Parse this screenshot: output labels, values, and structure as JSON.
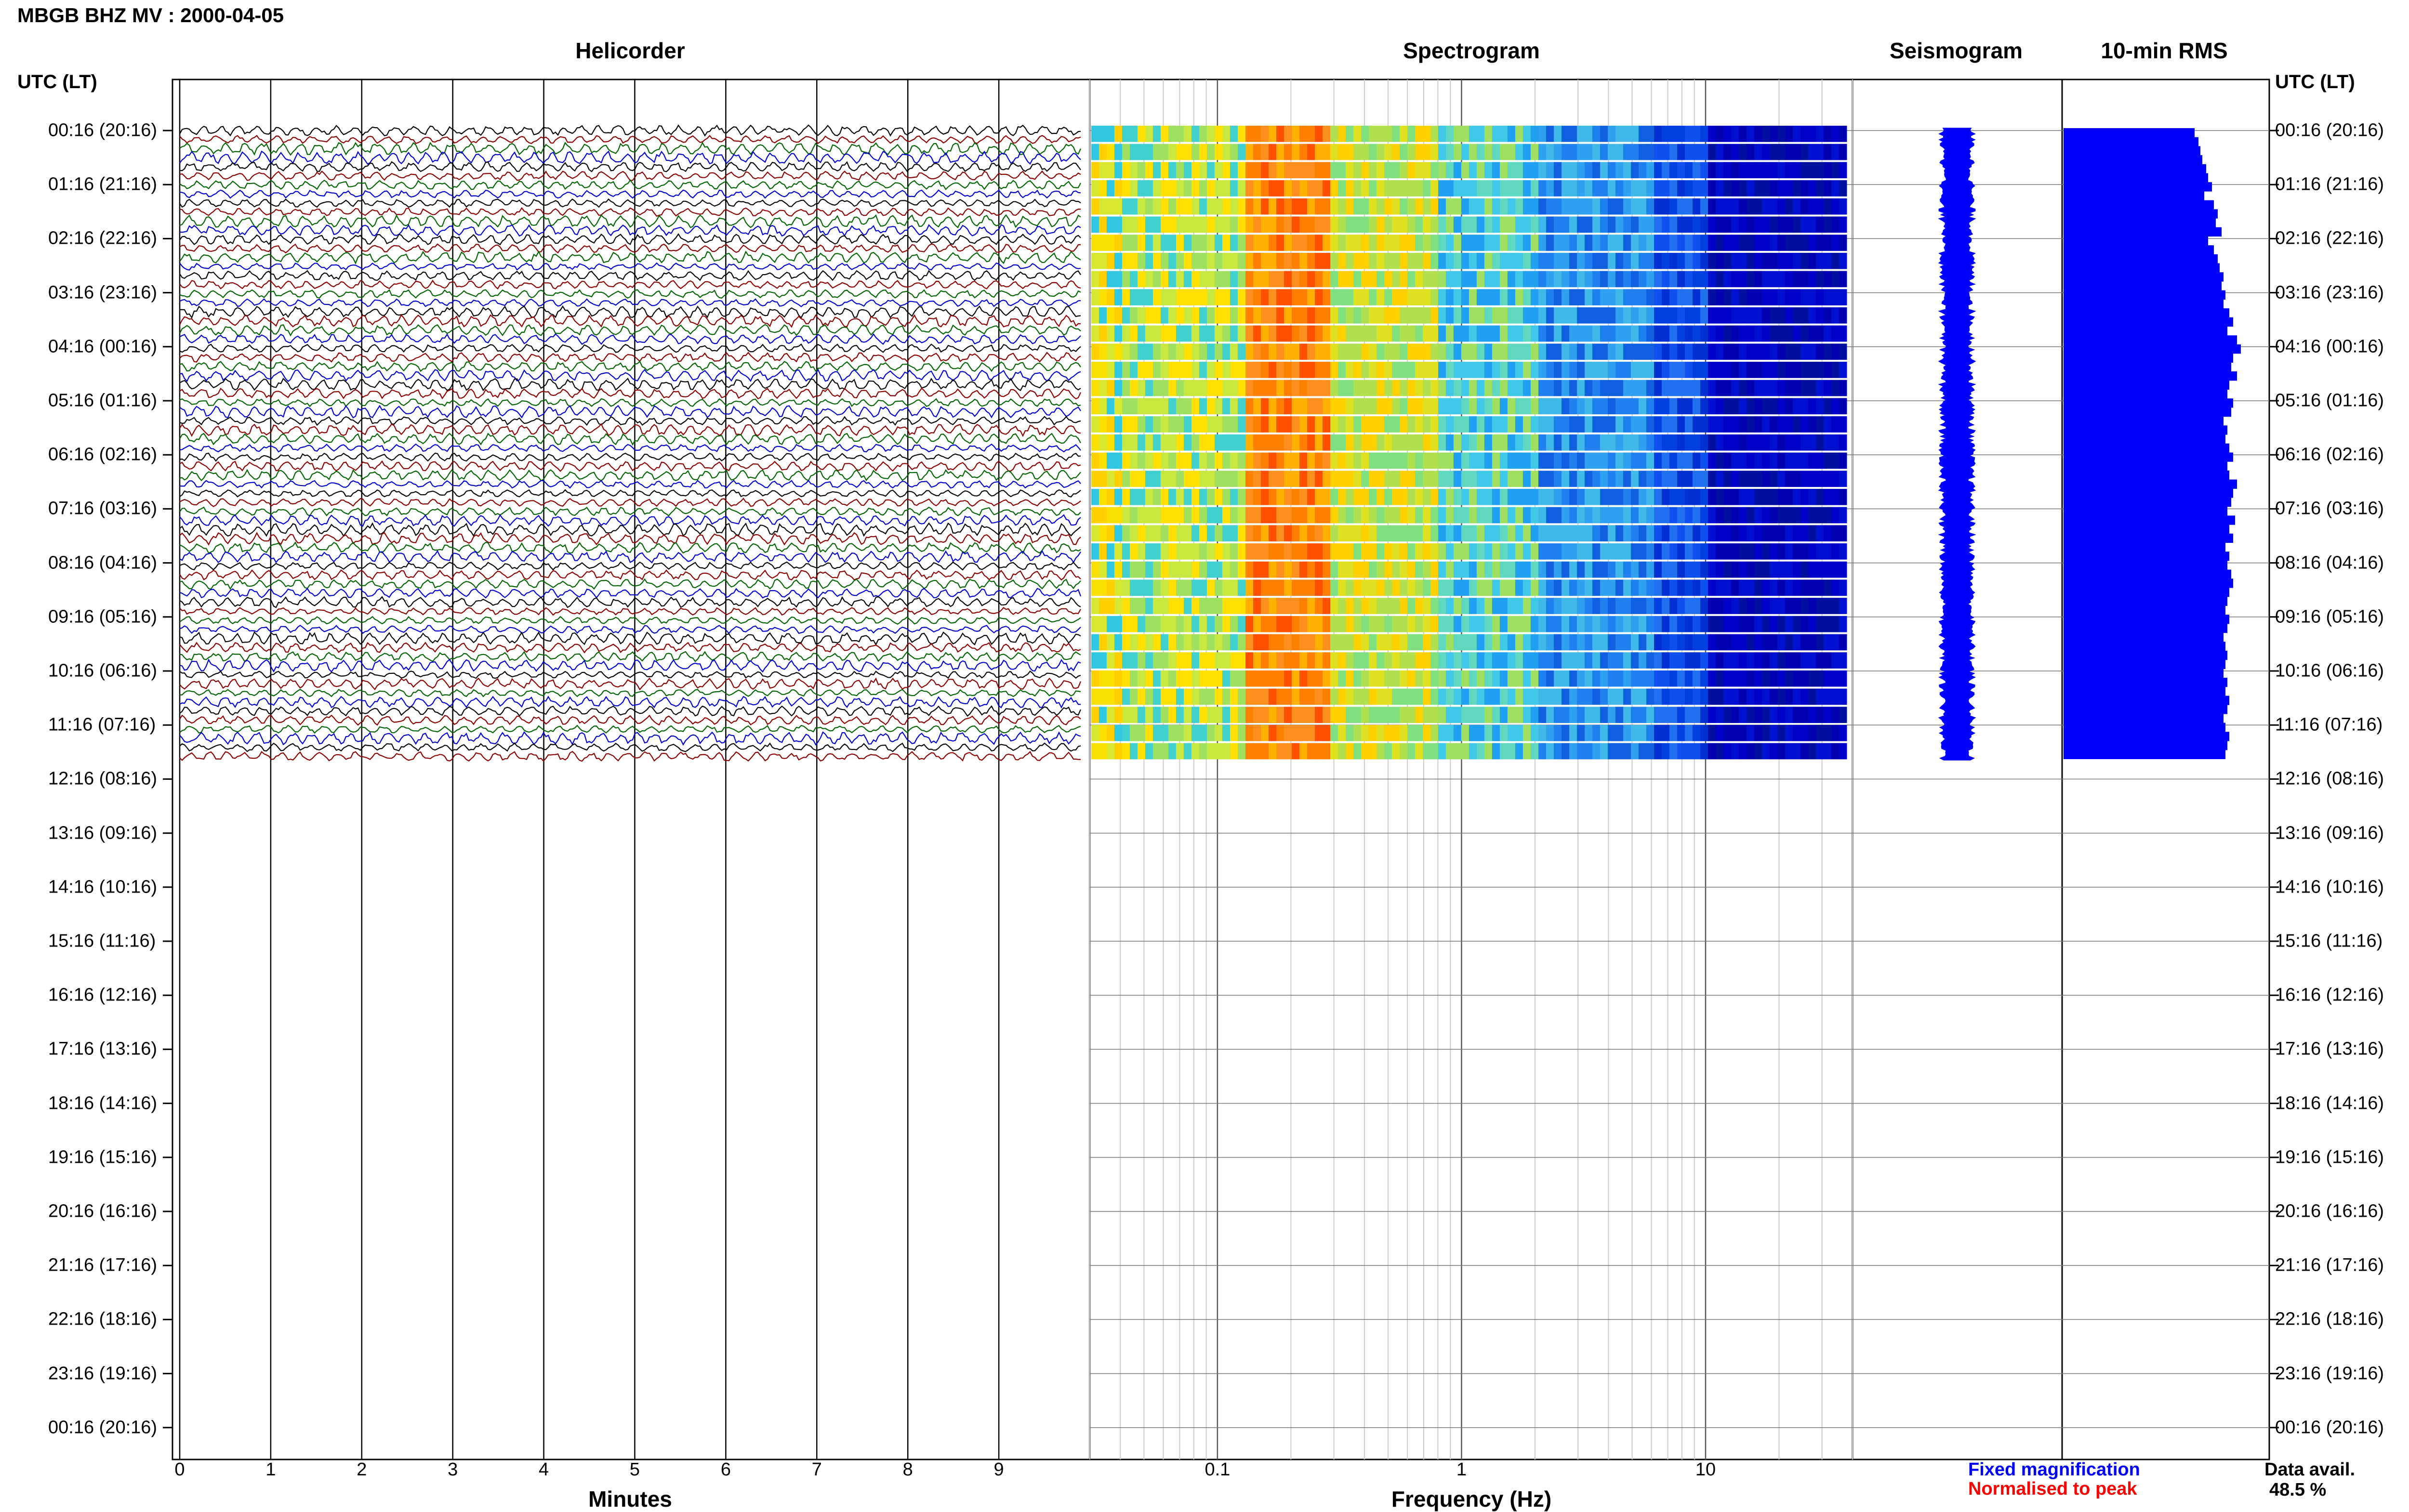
{
  "header": {
    "station_title": "MBGB BHZ MV : 2000-04-05"
  },
  "panels": {
    "helicorder": "Helicorder",
    "spectrogram": "Spectrogram",
    "seismogram": "Seismogram",
    "rms": "10-min RMS"
  },
  "axis_headers": {
    "left": "UTC (LT)",
    "right": "UTC (LT)"
  },
  "time_rows": [
    "00:16 (20:16)",
    "01:16 (21:16)",
    "02:16 (22:16)",
    "03:16 (23:16)",
    "04:16 (00:16)",
    "05:16 (01:16)",
    "06:16 (02:16)",
    "07:16 (03:16)",
    "08:16 (04:16)",
    "09:16 (05:16)",
    "10:16 (06:16)",
    "11:16 (07:16)",
    "12:16 (08:16)",
    "13:16 (09:16)",
    "14:16 (10:16)",
    "15:16 (11:16)",
    "16:16 (12:16)",
    "17:16 (13:16)",
    "18:16 (14:16)",
    "19:16 (15:16)",
    "20:16 (16:16)",
    "21:16 (17:16)",
    "22:16 (18:16)",
    "23:16 (19:16)",
    "00:16 (20:16)"
  ],
  "x_axes": {
    "helicorder_ticks": [
      "0",
      "1",
      "2",
      "3",
      "4",
      "5",
      "6",
      "7",
      "8",
      "9"
    ],
    "helicorder_title": "Minutes",
    "spectrogram_ticks": [
      "0.1",
      "1",
      "10"
    ],
    "spectrogram_title": "Frequency (Hz)"
  },
  "legend": {
    "fixed": "Fixed magnification",
    "normalised": "Normalised to peak",
    "fixed_color": "#0000ff",
    "normalised_color": "#ff0000"
  },
  "availability": {
    "label": "Data avail.",
    "value": "48.5 %"
  },
  "colors": {
    "trace_cycle": [
      "#000000",
      "#8b0000",
      "#006400",
      "#0000cd"
    ],
    "seismogram": "#0000ff",
    "rms": "#0000ff",
    "spectrogram_low": "#00008b",
    "spectrogram_high": "#ff4000"
  },
  "chart_data": {
    "type": "heatmap",
    "hours_with_data": 11.67,
    "helicorder_minutes_range": [
      0,
      10
    ],
    "spectrogram_freq_range_hz": [
      0.03,
      40
    ],
    "spectrogram_log_scale": true,
    "rms_relative": [
      0.68,
      0.7,
      0.71,
      0.72,
      0.74,
      0.75,
      0.77,
      0.73,
      0.78,
      0.8,
      0.79,
      0.82,
      0.75,
      0.78,
      0.8,
      0.81,
      0.83,
      0.82,
      0.84,
      0.83,
      0.86,
      0.88,
      0.85,
      0.9,
      0.92,
      0.88,
      0.87,
      0.9,
      0.86,
      0.85,
      0.88,
      0.87,
      0.83,
      0.85,
      0.84,
      0.86,
      0.88,
      0.85,
      0.86,
      0.9,
      0.88,
      0.87,
      0.85,
      0.89,
      0.86,
      0.88,
      0.84,
      0.86,
      0.85,
      0.87,
      0.88,
      0.86,
      0.85,
      0.84,
      0.86,
      0.85,
      0.83,
      0.84,
      0.85,
      0.84,
      0.83,
      0.85,
      0.84,
      0.86,
      0.85,
      0.83,
      0.84,
      0.86,
      0.85,
      0.84
    ]
  }
}
